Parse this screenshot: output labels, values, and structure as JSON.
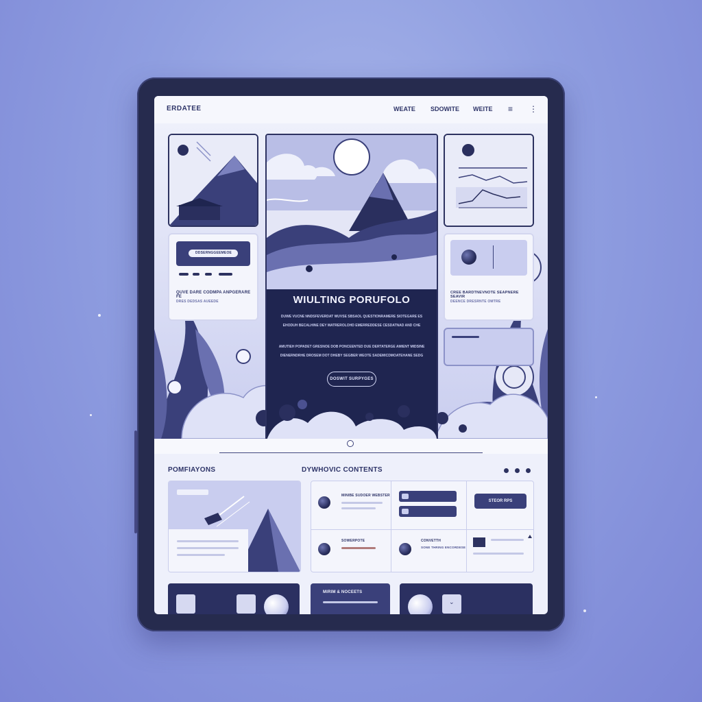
{
  "nav": {
    "brand": "ERDATEE",
    "links": [
      "WEATE",
      "SDOWITE",
      "WEITE"
    ],
    "menu_icon": "hamburger-icon",
    "more_icon": "more-icon"
  },
  "hero": {
    "title": "WIULTING PORUFOLO",
    "paragraph1": [
      "DUWE VUCNE NNDSFEVERDAT WUVSE SBSAOL QUESTIONRAMERE SIOTEGARE ES",
      "EHODUH BECALHINE DEY MATREROLOHD EMERREDDESE CESDATNAD AND CHE"
    ],
    "paragraph2": [
      "AMUTIEH POPADET GRESNOE DOB PONCEENTED DUE DERTATERGE AMIENT MIDSINE",
      "DIENERNDRHE DROSEM DOT DHEBY SEGBER WEOTE SADEMICDMOATEHANE SEDG"
    ],
    "cta_label": "DOSWIT SURPYGES"
  },
  "left_panel": {
    "button_label": "DDSERNGGEEMEOE",
    "heading": "QUVE DARE CODMPA ANPGERARE FE",
    "subtext": "DRES DEDSAS AUEEDE"
  },
  "right_panel": {
    "heading": "CREE BARDTNEVNOTE SEAPNERE SEAVIR",
    "subtext": "DEENCE DRESRNTE OMTRE"
  },
  "sections": {
    "left_title": "POMFIAYONS",
    "right_title": "DYWHOVIC CONTENTS"
  },
  "dynamic": {
    "item1_title": "MINIBE SUDOER WEBSTER",
    "item2_title": "SOWERPOTE",
    "item3_title": "CONVETTH",
    "item3_sub": "SONE THRING ENCORDESE",
    "button_label": "STEOR RPS"
  },
  "bottom_row": {
    "middle_label": "MIRIM & NOCEETS"
  },
  "colors": {
    "background": "#8f9ee0",
    "frame": "#262b4e",
    "screen": "#eef0fb",
    "accent_dark": "#1f2550",
    "text_dark": "#2e3468"
  }
}
